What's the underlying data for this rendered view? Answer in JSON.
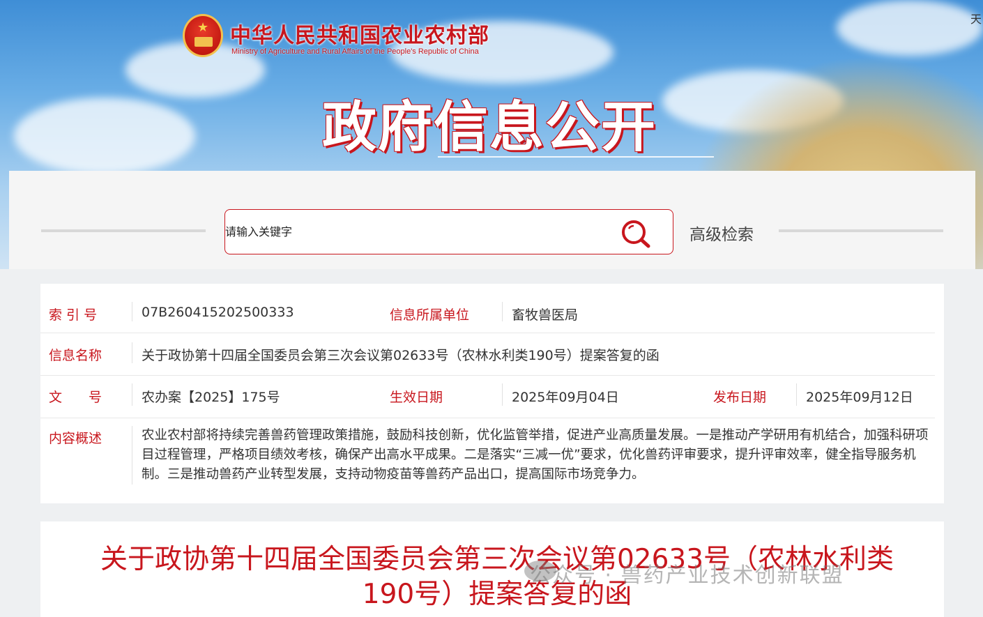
{
  "header": {
    "ministry_cn": "中华人民共和国农业农村部",
    "ministry_en": "Ministry of Agriculture and Rural Affairs of the People's Republic of China",
    "section_title": "政府信息公开",
    "corner_glyph": "天"
  },
  "search": {
    "placeholder": "请输入关键字",
    "advanced_label": "高级检索"
  },
  "info": {
    "index_label": "索 引 号",
    "index_value": "07B260415202500333",
    "unit_label": "信息所属单位",
    "unit_value": "畜牧兽医局",
    "name_label": "信息名称",
    "name_value": "关于政协第十四届全国委员会第三次会议第02633号（农林水利类190号）提案答复的函",
    "doc_label": "文　　号",
    "doc_value": "农办案【2025】175号",
    "effective_label": "生效日期",
    "effective_value": "2025年09月04日",
    "publish_label": "发布日期",
    "publish_value": "2025年09月12日",
    "summary_label": "内容概述",
    "summary_value": "农业农村部将持续完善兽药管理政策措施，鼓励科技创新，优化监管举措，促进产业高质量发展。一是推动产学研用有机结合，加强科研项目过程管理，严格项目绩效考核，确保产出高水平成果。二是落实“三减一优”要求，优化兽药评审要求，提升评审效率，健全指导服务机制。三是推动兽药产业转型发展，支持动物疫苗等兽药产品出口，提高国际市场竞争力。"
  },
  "article": {
    "title": "关于政协第十四届全国委员会第三次会议第02633号（农林水利类190号）提案答复的函"
  },
  "watermark": {
    "text": "公众号 · 兽药产业技术创新联盟"
  },
  "colors": {
    "accent": "#c8161d",
    "label": "#c8161d",
    "text": "#333333"
  },
  "icons": {
    "search": "search-icon",
    "emblem": "national-emblem-icon"
  }
}
